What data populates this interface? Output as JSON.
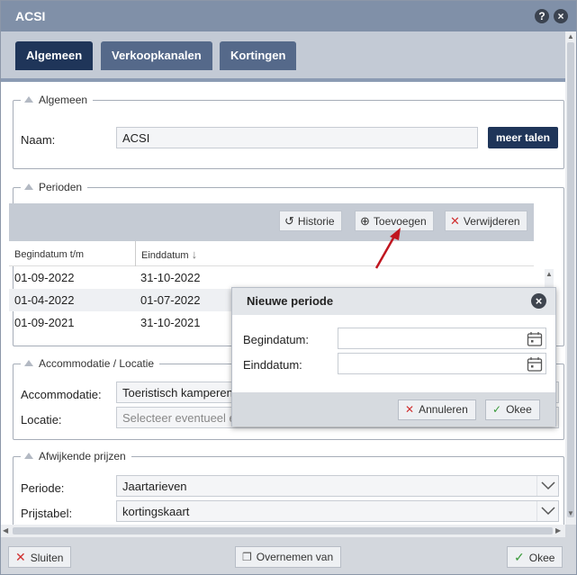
{
  "window": {
    "title": "ACSI",
    "help_icon": "?",
    "close_icon": "×"
  },
  "tabs": [
    {
      "label": "Algemeen",
      "active": true
    },
    {
      "label": "Verkoopkanalen",
      "active": false
    },
    {
      "label": "Kortingen",
      "active": false
    }
  ],
  "algemeen": {
    "legend": "Algemeen",
    "naam_label": "Naam:",
    "naam_value": "ACSI",
    "meer_talen": "meer talen"
  },
  "perioden": {
    "legend": "Perioden",
    "toolbar": {
      "historie": "Historie",
      "toevoegen": "Toevoegen",
      "verwijderen": "Verwijderen"
    },
    "columns": [
      "Begindatum t/m",
      "Einddatum"
    ],
    "rows": [
      [
        "01-09-2022",
        "31-10-2022"
      ],
      [
        "01-04-2022",
        "01-07-2022"
      ],
      [
        "01-09-2021",
        "31-10-2021"
      ]
    ]
  },
  "accommodatie": {
    "legend": "Accommodatie / Locatie",
    "accommodatie_label": "Accommodatie:",
    "accommodatie_value": "Toeristisch kamperen",
    "locatie_label": "Locatie:",
    "locatie_placeholder": "Selecteer eventueel e"
  },
  "prijzen": {
    "legend": "Afwijkende prijzen",
    "periode_label": "Periode:",
    "periode_value": "Jaartarieven",
    "prijstabel_label": "Prijstabel:",
    "prijstabel_value": "kortingskaart"
  },
  "dialog": {
    "title": "Nieuwe periode",
    "begindatum_label": "Begindatum:",
    "einddatum_label": "Einddatum:",
    "begindatum_value": "",
    "einddatum_value": "",
    "annuleren": "Annuleren",
    "okee": "Okee"
  },
  "footer": {
    "sluiten": "Sluiten",
    "overnemen": "Overnemen van",
    "okee": "Okee"
  },
  "colors": {
    "tab_active": "#1f3559",
    "tab_inactive": "#55698a",
    "titlebar": "#8090a8",
    "annotation_arrow": "#c0151f"
  }
}
